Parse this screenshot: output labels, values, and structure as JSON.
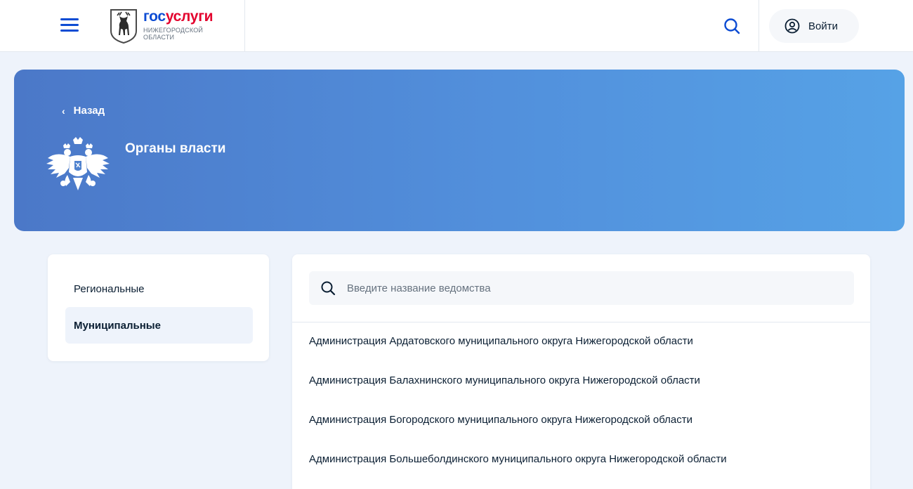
{
  "header": {
    "logo_title_part1": "гос",
    "logo_title_part2": "услуги",
    "logo_subtitle": "Нижегородской области",
    "login_label": "Войти",
    "icons": {
      "menu": "hamburger-menu-icon",
      "search": "search-icon",
      "user": "user-circle-icon"
    }
  },
  "banner": {
    "back_label": "Назад",
    "title": "Органы власти",
    "emblem": "double-headed-eagle-emblem"
  },
  "nav": {
    "items": [
      {
        "label": "Региональные",
        "active": false
      },
      {
        "label": "Муниципальные",
        "active": true
      }
    ]
  },
  "search": {
    "placeholder": "Введите название ведомства",
    "value": ""
  },
  "organizations": [
    "Администрация Ардатовского муниципального округа Нижегородской области",
    "Администрация Балахнинского муниципального округа Нижегородской области",
    "Администрация Богородского муниципального округа Нижегородской области",
    "Администрация Большеболдинского муниципального округа Нижегородской области"
  ],
  "colors": {
    "brand_blue": "#0d4cd3",
    "brand_red": "#e3002d",
    "banner_start": "#4b78c8",
    "banner_end": "#56a2e6",
    "page_bg": "#eef3fb"
  }
}
